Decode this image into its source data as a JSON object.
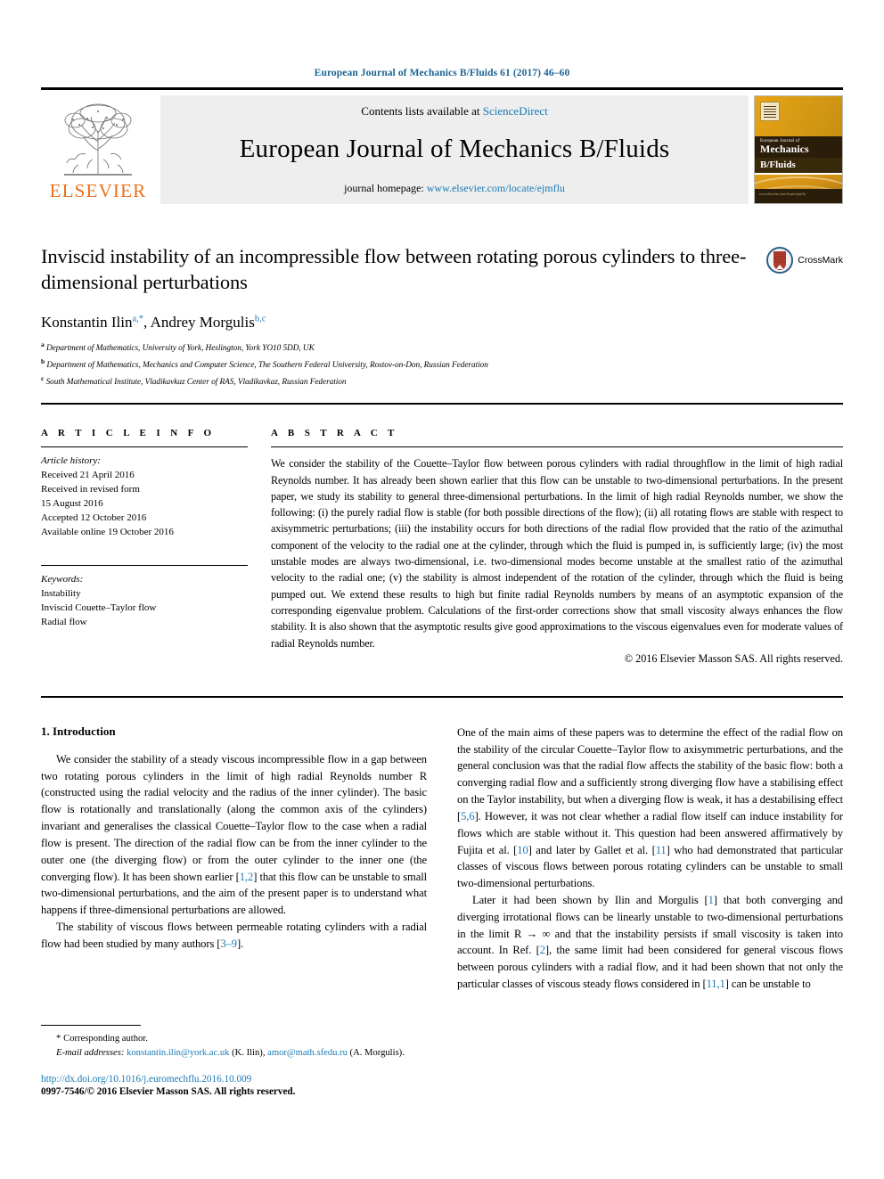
{
  "running_head": "European Journal of Mechanics B/Fluids 61 (2017) 46–60",
  "masthead": {
    "publisher_name": "ELSEVIER",
    "contents_line": "Contents lists available at ",
    "sciencedirect": "ScienceDirect",
    "journal_name": "European Journal of Mechanics B/Fluids",
    "homepage_label": "journal homepage: ",
    "homepage_url": "www.elsevier.com/locate/ejmflu",
    "cover": {
      "line1": "European Journal of",
      "line2": "Mechanics",
      "line3": "B/Fluids",
      "footer": "www.elsevier.com/locate/ejmflu"
    }
  },
  "article": {
    "title": "Inviscid instability of an incompressible flow between rotating porous cylinders to three-dimensional perturbations",
    "crossmark_label": "CrossMark",
    "authors": [
      {
        "name": "Konstantin Ilin",
        "marks": "a,*"
      },
      {
        "name": "Andrey Morgulis",
        "marks": "b,c"
      }
    ],
    "affiliations": [
      {
        "mark": "a",
        "text": "Department of Mathematics, University of York, Heslington, York YO10 5DD, UK"
      },
      {
        "mark": "b",
        "text": "Department of Mathematics, Mechanics and Computer Science, The Southern Federal University, Rostov-on-Don, Russian Federation"
      },
      {
        "mark": "c",
        "text": "South Mathematical Institute, Vladikavkaz Center of RAS, Vladikavkaz, Russian Federation"
      }
    ]
  },
  "article_info": {
    "heading": "A R T I C L E   I N F O",
    "history_label": "Article history:",
    "history": [
      "Received 21 April 2016",
      "Received in revised form",
      "15 August 2016",
      "Accepted 12 October 2016",
      "Available online 19 October 2016"
    ],
    "keywords_label": "Keywords:",
    "keywords": [
      "Instability",
      "Inviscid Couette–Taylor flow",
      "Radial flow"
    ]
  },
  "abstract": {
    "heading": "A B S T R A C T",
    "text": "We consider the stability of the Couette–Taylor flow between porous cylinders with radial throughflow in the limit of high radial Reynolds number. It has already been shown earlier that this flow can be unstable to two-dimensional perturbations. In the present paper, we study its stability to general three-dimensional perturbations. In the limit of high radial Reynolds number, we show the following: (i) the purely radial flow is stable (for both possible directions of the flow); (ii) all rotating flows are stable with respect to axisymmetric perturbations; (iii) the instability occurs for both directions of the radial flow provided that the ratio of the azimuthal component of the velocity to the radial one at the cylinder, through which the fluid is pumped in, is sufficiently large; (iv) the most unstable modes are always two-dimensional, i.e. two-dimensional modes become unstable at the smallest ratio of the azimuthal velocity to the radial one; (v) the stability is almost independent of the rotation of the cylinder, through which the fluid is being pumped out. We extend these results to high but finite radial Reynolds numbers by means of an asymptotic expansion of the corresponding eigenvalue problem. Calculations of the first-order corrections show that small viscosity always enhances the flow stability. It is also shown that the asymptotic results give good approximations to the viscous eigenvalues even for moderate values of radial Reynolds number.",
    "copyright": "© 2016 Elsevier Masson SAS. All rights reserved."
  },
  "body": {
    "section_heading": "1. Introduction",
    "left_paragraph_1_a": "We consider the stability of a steady viscous incompressible flow in a gap between two rotating porous cylinders in the limit of high radial Reynolds number R (constructed using the radial velocity and the radius of the inner cylinder). The basic flow is rotationally and translationally (along the common axis of the cylinders) invariant and generalises the classical Couette–Taylor flow to the case when a radial flow is present. The direction of the radial flow can be from the inner cylinder to the outer one (the diverging flow) or from the outer cylinder to the inner one (the converging flow). It has been shown earlier [",
    "left_ref_1": "1,2",
    "left_paragraph_1_b": "] that this flow can be unstable to small two-dimensional perturbations, and the aim of the present paper is to understand what happens if three-dimensional perturbations are allowed.",
    "left_paragraph_2_a": "The stability of viscous flows between permeable rotating cylinders with a radial flow had been studied by many authors [",
    "left_ref_2": "3–9",
    "left_paragraph_2_b": "].",
    "right_paragraph_1_a": "One of the main aims of these papers was to determine the effect of the radial flow on the stability of the circular Couette–Taylor flow to axisymmetric perturbations, and the general conclusion was that the radial flow affects the stability of the basic flow: both a converging radial flow and a sufficiently strong diverging flow have a stabilising effect on the Taylor instability, but when a diverging flow is weak, it has a destabilising effect [",
    "right_ref_1": "5,6",
    "right_paragraph_1_b": "]. However, it was not clear whether a radial flow itself can induce instability for flows which are stable without it. This question had been answered affirmatively by Fujita et al. [",
    "right_ref_2": "10",
    "right_paragraph_1_c": "] and later by Gallet et al. [",
    "right_ref_3": "11",
    "right_paragraph_1_d": "] who had demonstrated that particular classes of viscous flows between porous rotating cylinders can be unstable to small two-dimensional perturbations.",
    "right_paragraph_2_a": "Later it had been shown by Ilin and Morgulis [",
    "right_ref_4": "1",
    "right_paragraph_2_b": "] that both converging and diverging irrotational flows can be linearly unstable to two-dimensional perturbations in the limit R → ∞ and that the instability persists if small viscosity is taken into account. In Ref. [",
    "right_ref_5": "2",
    "right_paragraph_2_c": "], the same limit had been considered for general viscous flows between porous cylinders with a radial flow, and it had been shown that not only the particular classes of viscous steady flows considered in [",
    "right_ref_6": "11,1",
    "right_paragraph_2_d": "] can be unstable to"
  },
  "footnote": {
    "corresponding_star": "*",
    "corresponding_text": "Corresponding author.",
    "emails_label": "E-mail addresses:",
    "email_1": "konstantin.ilin@york.ac.uk",
    "email_1_owner": " (K. Ilin), ",
    "email_2": "amor@math.sfedu.ru",
    "email_2_owner": " (A. Morgulis).",
    "doi": "http://dx.doi.org/10.1016/j.euromechflu.2016.10.009",
    "issn_line": "0997-7546/© 2016 Elsevier Masson SAS. All rights reserved."
  },
  "colors": {
    "link_blue": "#1a7ab5",
    "header_blue": "#1a6496",
    "elsevier_orange": "#E9711C",
    "banner_grey": "#eeeeee"
  }
}
